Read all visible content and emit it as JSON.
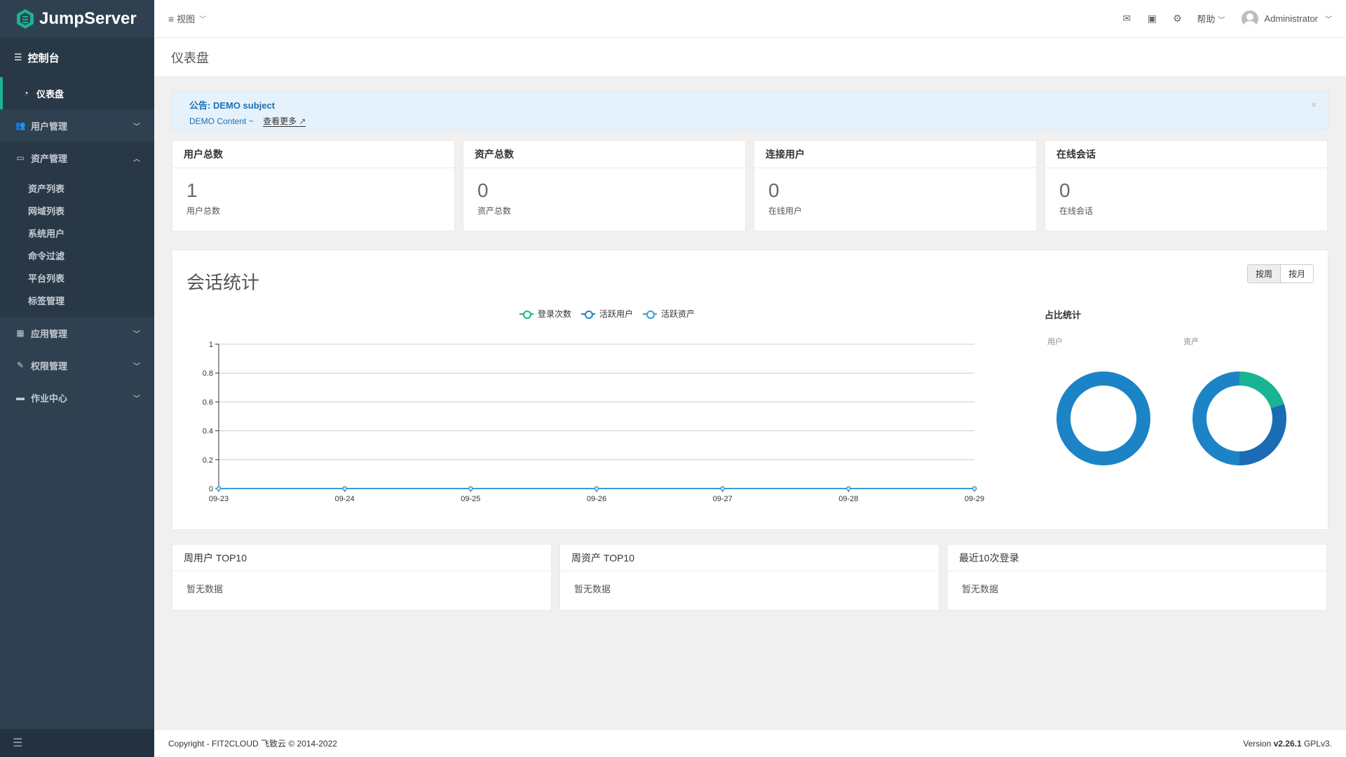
{
  "app": {
    "name": "JumpServer"
  },
  "sidebar": {
    "console_label": "控制台",
    "items": [
      {
        "label": "仪表盘",
        "icon": "dashboard-icon",
        "active": true
      },
      {
        "label": "用户管理",
        "icon": "users-icon"
      },
      {
        "label": "资产管理",
        "icon": "inbox-icon",
        "open": true,
        "children": [
          "资产列表",
          "网域列表",
          "系统用户",
          "命令过滤",
          "平台列表",
          "标签管理"
        ]
      },
      {
        "label": "应用管理",
        "icon": "grid-icon"
      },
      {
        "label": "权限管理",
        "icon": "edit-icon"
      },
      {
        "label": "作业中心",
        "icon": "terminal-icon"
      }
    ]
  },
  "topbar": {
    "view_label": "视图",
    "help_label": "帮助",
    "user_name": "Administrator"
  },
  "page": {
    "title": "仪表盘"
  },
  "announcement": {
    "title": "公告: DEMO subject",
    "content": "DEMO Content ~",
    "more_label": "查看更多",
    "close_glyph": "×"
  },
  "cards": [
    {
      "title": "用户总数",
      "value": "1",
      "sub": "用户总数"
    },
    {
      "title": "资产总数",
      "value": "0",
      "sub": "资产总数"
    },
    {
      "title": "连接用户",
      "value": "0",
      "sub": "在线用户"
    },
    {
      "title": "在线会话",
      "value": "0",
      "sub": "在线会话"
    }
  ],
  "session_stats": {
    "title": "会话统计",
    "range_buttons": [
      "按周",
      "按月"
    ],
    "legend": [
      {
        "name": "登录次数",
        "color": "#1ab394"
      },
      {
        "name": "活跃用户",
        "color": "#1c84c6"
      },
      {
        "name": "活跃资产",
        "color": "#3a9ad9"
      }
    ],
    "ratio_title": "占比统计",
    "donut_user_label": "用户",
    "donut_asset_label": "资产"
  },
  "chart_data": [
    {
      "type": "line",
      "x": [
        "09-23",
        "09-24",
        "09-25",
        "09-26",
        "09-27",
        "09-28",
        "09-29"
      ],
      "series": [
        {
          "name": "登录次数",
          "values": [
            0,
            0,
            0,
            0,
            0,
            0,
            0
          ],
          "color": "#1ab394"
        },
        {
          "name": "活跃用户",
          "values": [
            0,
            0,
            0,
            0,
            0,
            0,
            0
          ],
          "color": "#1c84c6"
        },
        {
          "name": "活跃资产",
          "values": [
            0,
            0,
            0,
            0,
            0,
            0,
            0
          ],
          "color": "#3a9ad9"
        }
      ],
      "ylim": [
        0,
        1
      ],
      "yticks": [
        0,
        0.2,
        0.4,
        0.6,
        0.8,
        1
      ],
      "grid": true,
      "legend_position": "top-center"
    },
    {
      "type": "pie",
      "subtitle": "用户",
      "slices": [
        {
          "value": 1,
          "color": "#1c84c6"
        }
      ],
      "donut": true
    },
    {
      "type": "pie",
      "subtitle": "资产",
      "slices": [
        {
          "value": 0.2,
          "color": "#1ab394"
        },
        {
          "value": 0.3,
          "color": "#1a6cb5"
        },
        {
          "value": 0.5,
          "color": "#1c84c6"
        }
      ],
      "donut": true
    }
  ],
  "bottom_panels": [
    {
      "title": "周用户 TOP10",
      "empty_text": "暂无数据"
    },
    {
      "title": "周资产 TOP10",
      "empty_text": "暂无数据"
    },
    {
      "title": "最近10次登录",
      "empty_text": "暂无数据"
    }
  ],
  "footer": {
    "copyright": "Copyright - FIT2CLOUD 飞致云 © 2014-2022",
    "version_prefix": "Version ",
    "version_number": "v2.26.1",
    "license": " GPLv3."
  }
}
